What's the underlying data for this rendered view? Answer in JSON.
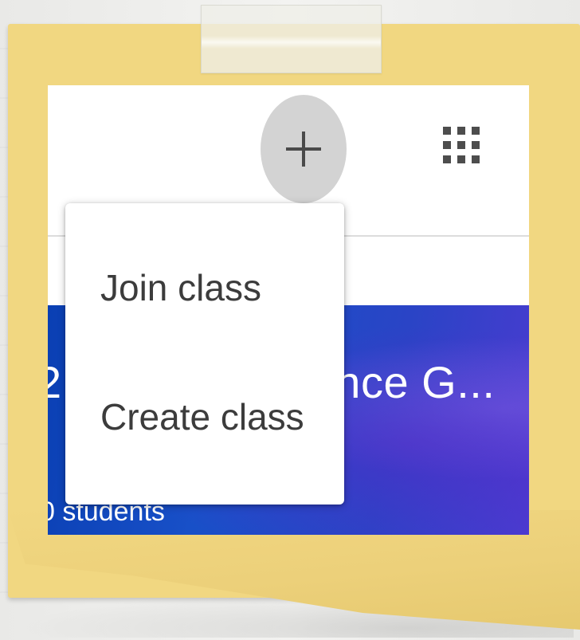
{
  "add_button": {
    "icon": "plus-icon"
  },
  "apps_button": {
    "icon": "apps-grid-icon"
  },
  "menu": {
    "items": [
      {
        "label": "Join class"
      },
      {
        "label": "Create class"
      }
    ]
  },
  "class_card": {
    "title_visible": "2",
    "title_right_visible": "ence G...",
    "students": "0 students"
  },
  "colors": {
    "note": "#f1d781",
    "card_blue": "#1850c8",
    "add_button_bg": "#d3d3d3",
    "menu_text": "#3c3c3c"
  }
}
